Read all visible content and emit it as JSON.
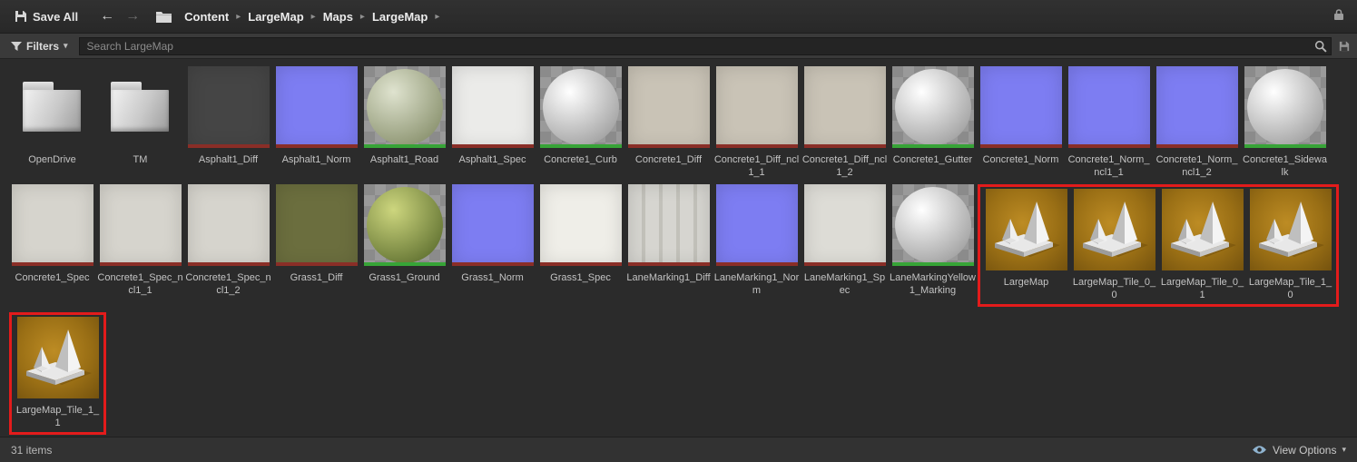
{
  "toolbar": {
    "save_all": "Save All",
    "breadcrumb": [
      "Content",
      "LargeMap",
      "Maps",
      "LargeMap"
    ]
  },
  "filter_bar": {
    "filters_label": "Filters",
    "search_placeholder": "Search LargeMap"
  },
  "colors": {
    "highlight_red": "#e31b1b",
    "texture_bar_red": "#8a2e27",
    "material_bar_green": "#37a437",
    "normal_map_blue": "#7d7df2"
  },
  "grid": {
    "rows": [
      [
        {
          "label": "OpenDrive",
          "type": "folder"
        },
        {
          "label": "TM",
          "type": "folder"
        },
        {
          "label": "Asphalt1_Diff",
          "type": "tex",
          "bg": "#454545",
          "bar": "#8a2e27"
        },
        {
          "label": "Asphalt1_Norm",
          "type": "tex",
          "bg": "#7d7df2",
          "bar": "#8a2e27"
        },
        {
          "label": "Asphalt1_Road",
          "type": "sphere",
          "ball": [
            "#dfe3cf",
            "#88906c"
          ],
          "bar": "#37a437"
        },
        {
          "label": "Asphalt1_Spec",
          "type": "tex",
          "bg": "#ebebe9",
          "bar": "#8a2e27"
        },
        {
          "label": "Concrete1_Curb",
          "type": "sphere",
          "ball": [
            "#ffffff",
            "#9e9e9e"
          ],
          "bar": "#37a437"
        },
        {
          "label": "Concrete1_Diff",
          "type": "tex",
          "bg": "#c9c3b6",
          "bar": "#8a2e27"
        },
        {
          "label": "Concrete1_Diff_ncl1_1",
          "type": "tex",
          "bg": "#c9c3b6",
          "bar": "#8a2e27"
        },
        {
          "label": "Concrete1_Diff_ncl1_2",
          "type": "tex",
          "bg": "#c9c3b6",
          "bar": "#8a2e27"
        },
        {
          "label": "Concrete1_Gutter",
          "type": "sphere",
          "ball": [
            "#ffffff",
            "#9e9e9e"
          ],
          "bar": "#37a437"
        },
        {
          "label": "Concrete1_Norm",
          "type": "tex",
          "bg": "#7d7df2",
          "bar": "#8a2e27"
        },
        {
          "label": "Concrete1_Norm_ncl1_1",
          "type": "tex",
          "bg": "#7d7df2",
          "bar": "#8a2e27"
        },
        {
          "label": "Concrete1_Norm_ncl1_2",
          "type": "tex",
          "bg": "#7d7df2",
          "bar": "#8a2e27"
        },
        {
          "label": "Concrete1_Sidewalk",
          "type": "sphere",
          "ball": [
            "#ffffff",
            "#9e9e9e"
          ],
          "bar": "#37a437"
        }
      ],
      [
        {
          "label": "Concrete1_Spec",
          "type": "tex",
          "bg": "#d6d4cd",
          "bar": "#8a2e27"
        },
        {
          "label": "Concrete1_Spec_ncl1_1",
          "type": "tex",
          "bg": "#d6d4cd",
          "bar": "#8a2e27"
        },
        {
          "label": "Concrete1_Spec_ncl1_2",
          "type": "tex",
          "bg": "#d6d4cd",
          "bar": "#8a2e27"
        },
        {
          "label": "Grass1_Diff",
          "type": "tex",
          "bg": "#6b6e3e",
          "bar": "#8a2e27"
        },
        {
          "label": "Grass1_Ground",
          "type": "sphere",
          "ball": [
            "#cdd67e",
            "#5f7030"
          ],
          "bar": "#37a437"
        },
        {
          "label": "Grass1_Norm",
          "type": "tex",
          "bg": "#7d7df2",
          "bar": "#8a2e27"
        },
        {
          "label": "Grass1_Spec",
          "type": "tex",
          "bg": "#efeee8",
          "bar": "#8a2e27"
        },
        {
          "label": "LaneMarking1_Diff",
          "type": "tex",
          "bg": "#d6d5d0",
          "variant": "stripes",
          "bar": "#8a2e27"
        },
        {
          "label": "LaneMarking1_Norm",
          "type": "tex",
          "bg": "#7d7df2",
          "bar": "#8a2e27"
        },
        {
          "label": "LaneMarking1_Spec",
          "type": "tex",
          "bg": "#dddcd6",
          "bar": "#8a2e27"
        },
        {
          "label": "LaneMarkingYellow1_Marking",
          "type": "sphere",
          "ball": [
            "#ffffff",
            "#9e9e9e"
          ],
          "bar": "#37a437"
        },
        {
          "label": "LargeMap",
          "type": "level",
          "highlighted": true
        },
        {
          "label": "LargeMap_Tile_0_0",
          "type": "level",
          "highlighted": true
        },
        {
          "label": "LargeMap_Tile_0_1",
          "type": "level",
          "highlighted": true
        },
        {
          "label": "LargeMap_Tile_1_0",
          "type": "level",
          "highlighted": true
        }
      ],
      [
        {
          "label": "LargeMap_Tile_1_1",
          "type": "level",
          "highlighted": true
        }
      ]
    ]
  },
  "footer": {
    "item_count": "31 items",
    "view_options": "View Options"
  }
}
